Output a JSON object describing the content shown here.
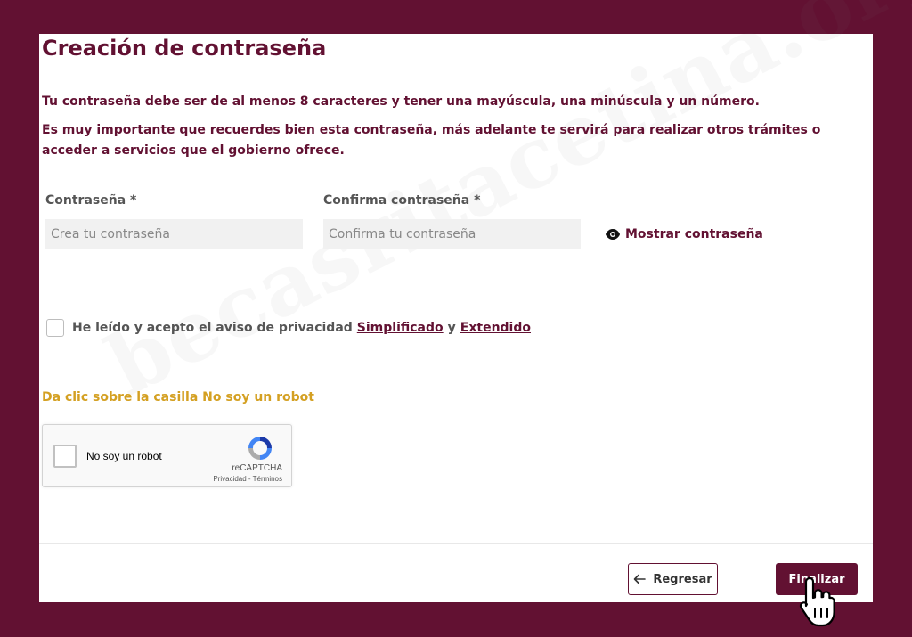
{
  "page": {
    "title": "Creación de contraseña",
    "instruction_1": "Tu contraseña debe ser de al menos 8 caracteres y tener una mayúscula, una minúscula y un número.",
    "instruction_2": "Es muy importante que recuerdes bien esta contraseña, más adelante te servirá para realizar otros trámites o acceder a servicios que el gobierno ofrece.",
    "watermark": "becasritacetina.org"
  },
  "form": {
    "password_label": "Contraseña *",
    "password_placeholder": "Crea tu contraseña",
    "confirm_label": "Confirma contraseña *",
    "confirm_placeholder": "Confirma tu contraseña",
    "show_password": "Mostrar contraseña",
    "privacy_text": "He leído y acepto el aviso de privacidad",
    "privacy_link_simplified": "Simplificado",
    "privacy_conjunction": "y",
    "privacy_link_extended": "Extendido",
    "robot_hint": "Da clic sobre la casilla No soy un robot"
  },
  "recaptcha": {
    "label": "No soy un robot",
    "brand": "reCAPTCHA",
    "links": "Privacidad - Términos"
  },
  "actions": {
    "back": "Regresar",
    "finish": "Finalizar"
  },
  "colors": {
    "brand": "#621132",
    "hint": "#d4a022",
    "field_bg": "#f1f1f1"
  }
}
